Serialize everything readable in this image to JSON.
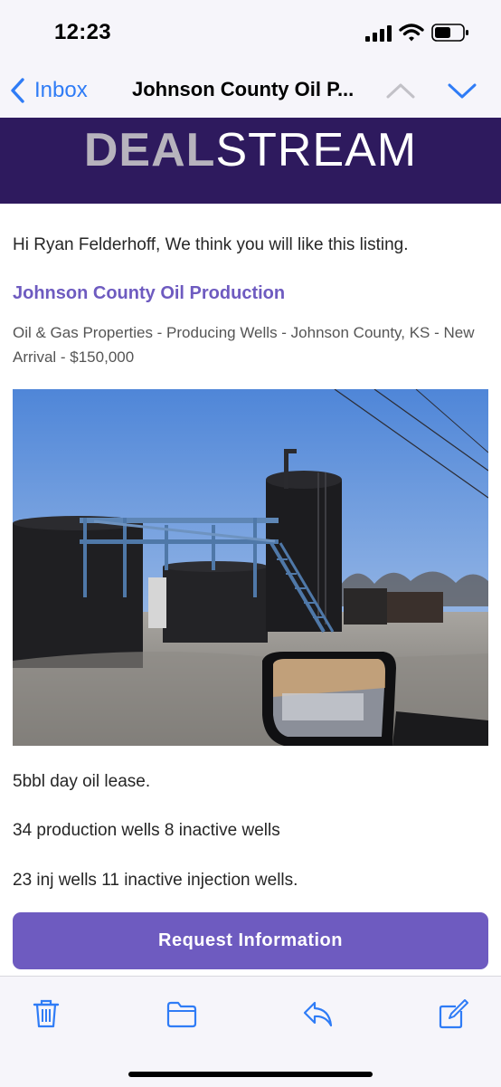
{
  "status_bar": {
    "time": "12:23"
  },
  "nav": {
    "back_label": "Inbox",
    "title": "Johnson County Oil P..."
  },
  "banner": {
    "logo_part1": "DEAL",
    "logo_part2": "STREAM"
  },
  "email": {
    "greeting": "Hi Ryan Felderhoff, We think you will like this listing.",
    "listing_title": "Johnson County Oil Production",
    "listing_meta": "Oil & Gas Properties - Producing Wells - Johnson County, KS - New Arrival - $150,000",
    "photo_alt": "Oil tank battery with catwalk and stairs",
    "lines": [
      "5bbl day oil lease.",
      "34 production wells 8 inactive wells",
      "23 inj wells 11 inactive injection wells."
    ],
    "cta_label": "Request Information"
  },
  "colors": {
    "accent": "#6e5bc0",
    "banner": "#2e1a5e",
    "ios_blue": "#2f7cf6"
  },
  "icons": [
    "signal-icon",
    "wifi-icon",
    "battery-icon",
    "back-chevron-icon",
    "chevron-up-icon",
    "chevron-down-icon",
    "trash-icon",
    "folder-icon",
    "reply-icon",
    "compose-icon"
  ]
}
